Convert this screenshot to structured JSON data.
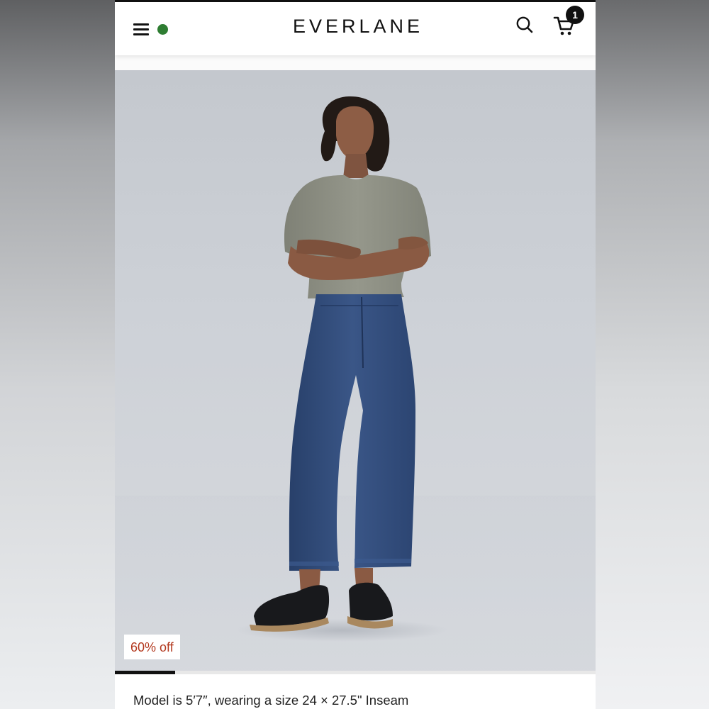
{
  "header": {
    "logo": "EVERLANE",
    "menu_icon": "hamburger-menu-icon",
    "status_dot_color": "#2e7d32",
    "search_icon": "search-icon",
    "cart_icon": "shopping-cart-icon",
    "cart_count": "1"
  },
  "product": {
    "image_alt": "Model wearing olive tee and dark wash straight jeans with black loafers",
    "discount_label": "60% off",
    "gallery_progress": 0.125,
    "model_caption": "Model is 5′7″, wearing a size 24 × 27.5\" Inseam"
  },
  "colors": {
    "discount_text": "#b3391f",
    "shirt": "#8a8c80",
    "denim": "#2f4a78"
  }
}
